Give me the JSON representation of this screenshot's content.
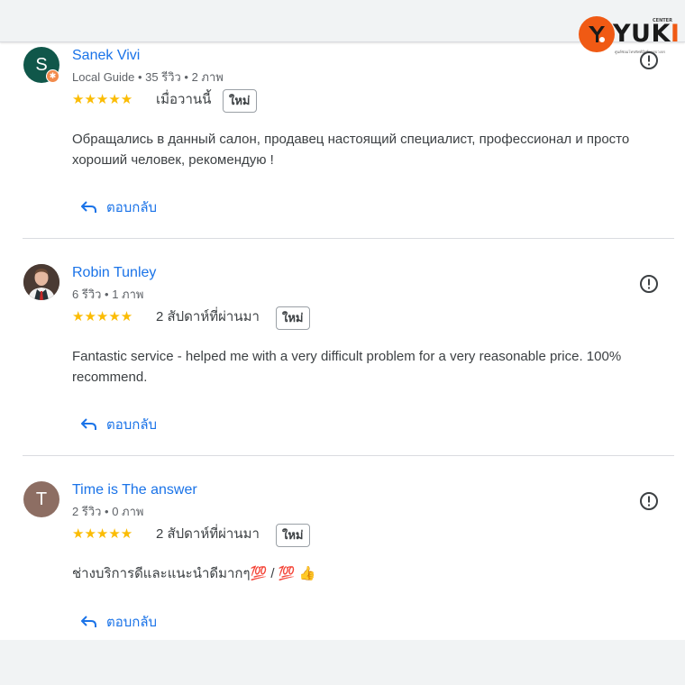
{
  "logo": {
    "word_main": "YUK",
    "word_last": "I",
    "center_label": "CENTER",
    "tagline": "ศูนย์ซ่อมโทรศัพท์มือถือครบวงจร"
  },
  "reviews": [
    {
      "avatar_letter": "S",
      "avatar_color": "#10574a",
      "name": "Sanek Vivi",
      "meta": "Local Guide • 35 รีวิว • 2 ภาพ",
      "rating": 5,
      "stars": "★★★★★",
      "when": "เมื่อวานนี้",
      "badge": "ใหม่",
      "text": "Обращались в данный салон, продавец настоящий специалист, профессионал и просто хороший человек, рекомендую !",
      "reply_label": "ตอบกลับ"
    },
    {
      "avatar_letter": "",
      "name": "Robin Tunley",
      "meta": "6 รีวิว • 1 ภาพ",
      "rating": 5,
      "stars": "★★★★★",
      "when": "2 สัปดาห์ที่ผ่านมา",
      "badge": "ใหม่",
      "text": "Fantastic service - helped me with a very difficult problem for a very reasonable price. 100% recommend.",
      "reply_label": "ตอบกลับ"
    },
    {
      "avatar_letter": "T",
      "avatar_color": "#8d6e63",
      "name": "Time is The answer",
      "meta": "2 รีวิว • 0 ภาพ",
      "rating": 5,
      "stars": "★★★★★",
      "when": "2 สัปดาห์ที่ผ่านมา",
      "badge": "ใหม่",
      "text": "ช่างบริการดีและแนะนำดีมากๆ💯 / 💯 👍",
      "reply_label": "ตอบกลับ"
    }
  ],
  "icons": {
    "flag": "report-flag-icon",
    "reply": "reply-arrow-icon",
    "star": "star-icon"
  },
  "colors": {
    "accent": "#1a73e8",
    "star": "#fbbc04",
    "brand": "#f05a14"
  }
}
